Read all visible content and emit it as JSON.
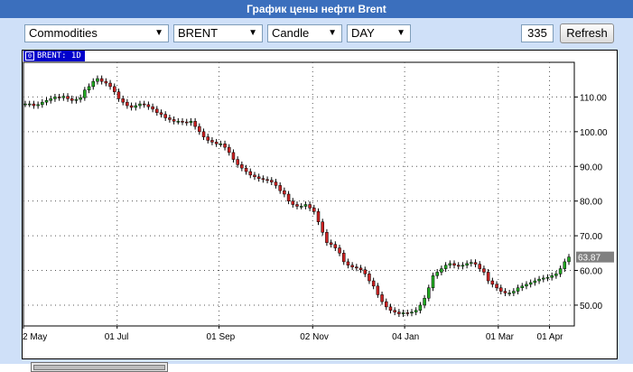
{
  "title": "График цены нефти Brent",
  "toolbar": {
    "category": "Commodities",
    "symbol": "BRENT",
    "chart_style": "Candle",
    "period": "DAY",
    "bars": "335",
    "refresh_label": "Refresh"
  },
  "chart_label": "BRENT: 1D",
  "colors": {
    "title_bg": "#3b6fbd",
    "panel_bg": "#cfe0f8",
    "up": "#22aa22",
    "down": "#cc2222",
    "price_tag": "#808080"
  },
  "chart_data": {
    "type": "candlestick",
    "title": "",
    "xlabel": "",
    "ylabel": "",
    "x_tick_labels": [
      "2 May",
      "01 Jul",
      "01 Sep",
      "02 Nov",
      "04 Jan",
      "01 Mar",
      "01 Apr"
    ],
    "y_tick_labels": [
      "110.00",
      "100.00",
      "90.00",
      "80.00",
      "70.00",
      "60.00",
      "50.00"
    ],
    "ylim": [
      44,
      120
    ],
    "grid": true,
    "last_price": "63.87",
    "series": [
      {
        "values": [
          108,
          108,
          107.5,
          107.8,
          108.5,
          109,
          109.5,
          110,
          109.8,
          110.2,
          109.5,
          109,
          109.3,
          109.8,
          112,
          113,
          114.5,
          115.3,
          114.5,
          114,
          113,
          111.5,
          109.5,
          108.5,
          107.5,
          107,
          107.5,
          108,
          107.8,
          107.2,
          106.5,
          105.5,
          105,
          104,
          103.5,
          103,
          103,
          102.8,
          102.6,
          103,
          101.5,
          100,
          98.5,
          97.5,
          97,
          96.5,
          96.5,
          95.5,
          94,
          92,
          90.5,
          89.5,
          88.5,
          87.5,
          87,
          86.5,
          86.2,
          86,
          85.5,
          84.5,
          83,
          82,
          80,
          79,
          78.5,
          78.5,
          79,
          78,
          77,
          74,
          71,
          68,
          67.5,
          66.5,
          65,
          62.5,
          61.5,
          61,
          60.7,
          60.2,
          59,
          57,
          55.5,
          53,
          51,
          49.5,
          48.5,
          48,
          47.5,
          47.8,
          47.7,
          48,
          48.5,
          50,
          52,
          55,
          58.5,
          59.5,
          60.5,
          61.5,
          62,
          61.5,
          61.2,
          61.5,
          62,
          62.3,
          61.8,
          60.5,
          59.5,
          57,
          56,
          55,
          54,
          53.5,
          53.5,
          54,
          55,
          55.5,
          56,
          56.5,
          57,
          57.5,
          57.8,
          58,
          58.5,
          59,
          60.5,
          62.5,
          63.87
        ]
      }
    ]
  }
}
